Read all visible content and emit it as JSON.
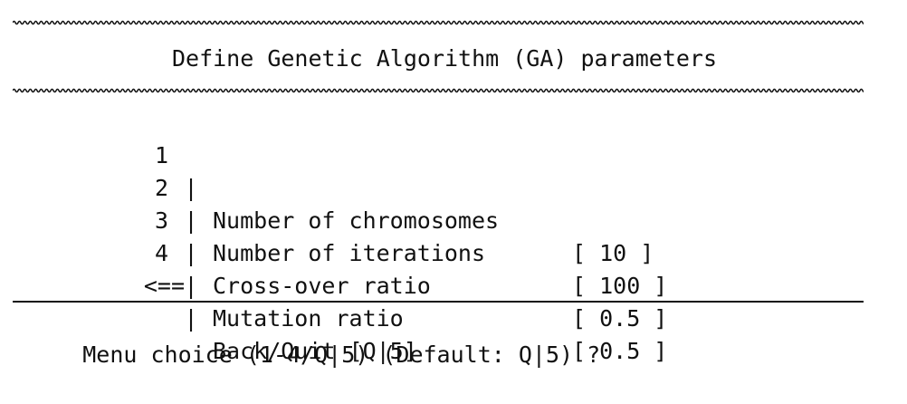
{
  "title": "Define Genetic Algorithm (GA) parameters",
  "menu": {
    "items": [
      {
        "key": "1",
        "label": "Number of chromosomes",
        "value": "[ 10 ]"
      },
      {
        "key": "2",
        "label": "Number of iterations",
        "value": "[ 100 ]"
      },
      {
        "key": "3",
        "label": "Cross-over ratio",
        "value": "[ 0.5 ]"
      },
      {
        "key": "4",
        "label": "Mutation ratio",
        "value": "[ 0.5 ]"
      }
    ],
    "separator": "|",
    "back": {
      "key": "<==",
      "label": "Back/Quit [Q|5]"
    }
  },
  "prompt": "Menu choice (1-4/Q|5) (Default: Q|5) ?"
}
